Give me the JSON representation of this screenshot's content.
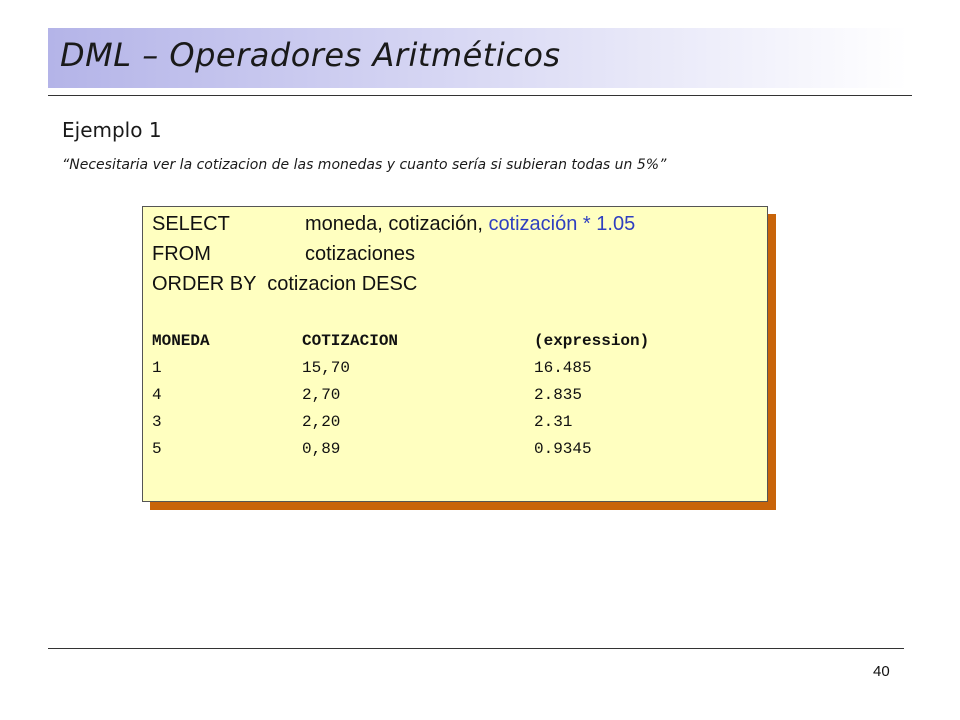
{
  "slide": {
    "title": "DML – Operadores Aritméticos",
    "subtitle": "Ejemplo 1",
    "quote": "“Necesitaria ver la cotizacion de las monedas y cuanto sería si subieran todas un 5%”",
    "page_number": "40"
  },
  "query": {
    "select_kw": "SELECT",
    "select_cols": "moneda, cotización, ",
    "select_highlight": "cotización * 1.05",
    "from_kw": "FROM",
    "from_table": "cotizaciones",
    "order_line": "ORDER BY  cotizacion DESC",
    "highlight_color": "#2f3fc0"
  },
  "result": {
    "headers": [
      "MONEDA",
      "COTIZACION",
      "(expression)"
    ],
    "rows": [
      [
        "1",
        "15,70",
        "16.485"
      ],
      [
        "4",
        "2,70",
        "2.835"
      ],
      [
        "3",
        "2,20",
        "2.31"
      ],
      [
        "5",
        "0,89",
        "0.9345"
      ]
    ]
  },
  "colors": {
    "title_band": "#b4b4e8",
    "code_bg": "#ffffc0",
    "code_shadow": "#c8640a"
  }
}
